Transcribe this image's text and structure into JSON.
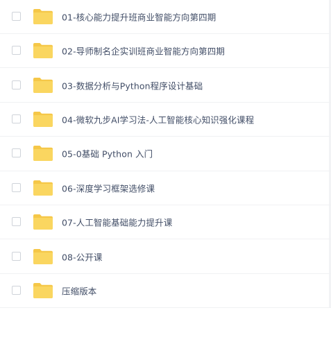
{
  "file_list": {
    "items": [
      {
        "name": "01-核心能力提升班商业智能方向第四期",
        "type": "folder",
        "icon": "folder-icon"
      },
      {
        "name": "02-导师制名企实训班商业智能方向第四期",
        "type": "folder",
        "icon": "folder-icon"
      },
      {
        "name": "03-数据分析与Python程序设计基础",
        "type": "folder",
        "icon": "folder-icon"
      },
      {
        "name": "04-微软九步AI学习法-人工智能核心知识强化课程",
        "type": "folder",
        "icon": "folder-icon"
      },
      {
        "name": "05-0基础 Python 入门",
        "type": "folder",
        "icon": "folder-icon"
      },
      {
        "name": "06-深度学习框架选修课",
        "type": "folder",
        "icon": "folder-icon"
      },
      {
        "name": "07-人工智能基础能力提升课",
        "type": "folder",
        "icon": "folder-icon"
      },
      {
        "name": "08-公开课",
        "type": "folder",
        "icon": "folder-icon"
      },
      {
        "name": "压缩版本",
        "type": "folder",
        "icon": "folder-icon"
      }
    ]
  },
  "colors": {
    "folder_back": "#f5c748",
    "folder_front": "#fad660",
    "text": "#424e67",
    "divider": "#f0f1f3",
    "checkbox_border": "#cfd3d9"
  }
}
